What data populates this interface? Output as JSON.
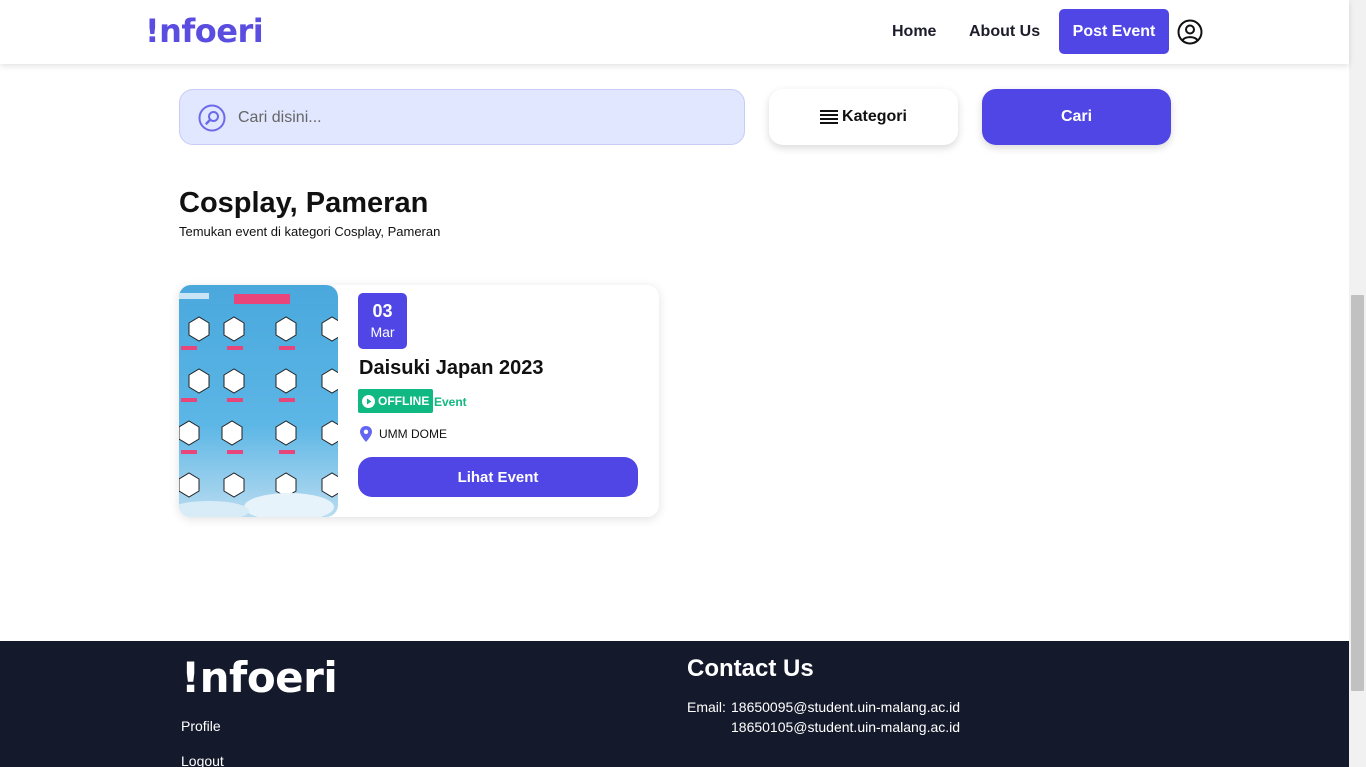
{
  "navbar": {
    "logo": "!nfoeri",
    "home_label": "Home",
    "about_label": "About Us",
    "post_event_label": "Post Event"
  },
  "search": {
    "placeholder": "Cari disini...",
    "value": "",
    "kategori_label": "Kategori",
    "cari_label": "Cari"
  },
  "page": {
    "title": "Cosplay, Pameran",
    "subtitle": "Temukan event di kategori Cosplay, Pameran"
  },
  "events": [
    {
      "day": "03",
      "month": "Mar",
      "title": "Daisuki Japan 2023",
      "mode": "OFFLINE",
      "type": "Event",
      "location": "UMM DOME",
      "button_label": "Lihat Event"
    }
  ],
  "footer": {
    "logo": "!nfoeri",
    "profile_label": "Profile",
    "logout_label": "Logout",
    "contact_title": "Contact Us",
    "email_label": "Email:",
    "emails": [
      "18650095@student.uin-malang.ac.id",
      "18650105@student.uin-malang.ac.id"
    ]
  },
  "colors": {
    "primary": "#4f46e5",
    "search_bg": "#e0e7ff",
    "success": "#10b981",
    "footer_bg": "#141a2b"
  }
}
